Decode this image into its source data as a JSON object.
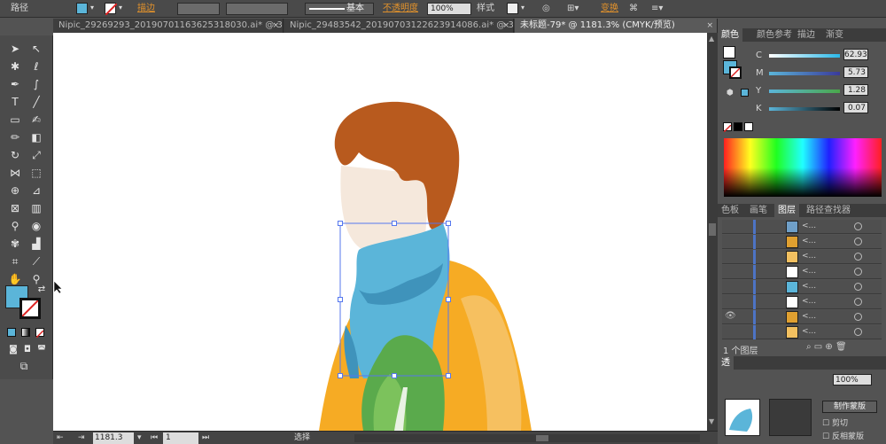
{
  "control_bar": {
    "path_label": "路径",
    "fill_color": "#5bb5d9",
    "stroke_label": "描边",
    "stroke_style_label": "基本",
    "opacity_label": "不透明度",
    "opacity_value": "100%",
    "style_label": "样式",
    "transform_label": "变换"
  },
  "tabs": [
    {
      "label": "Nipic_29269293_20190701163625318030.ai* @ 33...",
      "close": "×"
    },
    {
      "label": "Nipic_29483542_20190703122623914086.ai* @ 33...",
      "close": "×"
    },
    {
      "label": "未标题-79* @ 1181.3% (CMYK/预览)",
      "close": "×"
    }
  ],
  "tool_icons": [
    "selection-icon",
    "direct-selection-icon",
    "magic-wand-icon",
    "lasso-icon",
    "pen-icon",
    "curvature-icon",
    "type-icon",
    "line-icon",
    "rectangle-icon",
    "paintbrush-icon",
    "pencil-icon",
    "eraser-icon",
    "rotate-icon",
    "scale-icon",
    "width-icon",
    "free-transform-icon",
    "shape-builder-icon",
    "perspective-icon",
    "mesh-icon",
    "gradient-icon",
    "eyedropper-icon",
    "blend-icon",
    "symbol-sprayer-icon",
    "column-graph-icon",
    "artboard-icon",
    "slice-icon",
    "hand-icon",
    "zoom-icon"
  ],
  "status_bar": {
    "zoom": "1181.3",
    "page": "1",
    "mode": "选择"
  },
  "color_panel": {
    "tabs": [
      "颜色",
      "颜色参考",
      "描边",
      "渐变"
    ],
    "channels": [
      {
        "name": "C",
        "value": "62.93",
        "color": "#5bb5d9"
      },
      {
        "name": "M",
        "value": "5.73",
        "color": "#a050a0"
      },
      {
        "name": "Y",
        "value": "1.28",
        "color": "#c8c830"
      },
      {
        "name": "K",
        "value": "0.07",
        "color": "#111111"
      }
    ]
  },
  "layers_panel": {
    "tabs": [
      "色板",
      "画笔",
      "图层",
      "路径查找器"
    ],
    "rows": [
      {
        "name": "<...",
        "thumb": "#6f9fc8"
      },
      {
        "name": "<...",
        "thumb": "#e0a030"
      },
      {
        "name": "<...",
        "thumb": "#f2c060"
      },
      {
        "name": "<...",
        "thumb": "#ffffff"
      },
      {
        "name": "<...",
        "thumb": "#5bb5d9"
      },
      {
        "name": "<...",
        "thumb": "#ffffff"
      },
      {
        "name": "<...",
        "thumb": "#e0a030"
      },
      {
        "name": "<...",
        "thumb": "#f2c060"
      }
    ],
    "layer_count": "1 个图层"
  },
  "transparency_panel": {
    "tab_label": "透",
    "opacity_value": "100%",
    "make_mask_label": "制作蒙版",
    "clip_label": "剪切",
    "invert_mask_label": "反相蒙版"
  },
  "colors": {
    "hair": "#b85a1e",
    "face": "#f5e8dc",
    "scarf": "#5bb5d9",
    "scarf_shadow": "#3f93bb",
    "coat": "#f6ab24",
    "coat_light": "#f6c060",
    "leaf": "#5aaa4c",
    "leaf_light": "#7cc25c"
  }
}
